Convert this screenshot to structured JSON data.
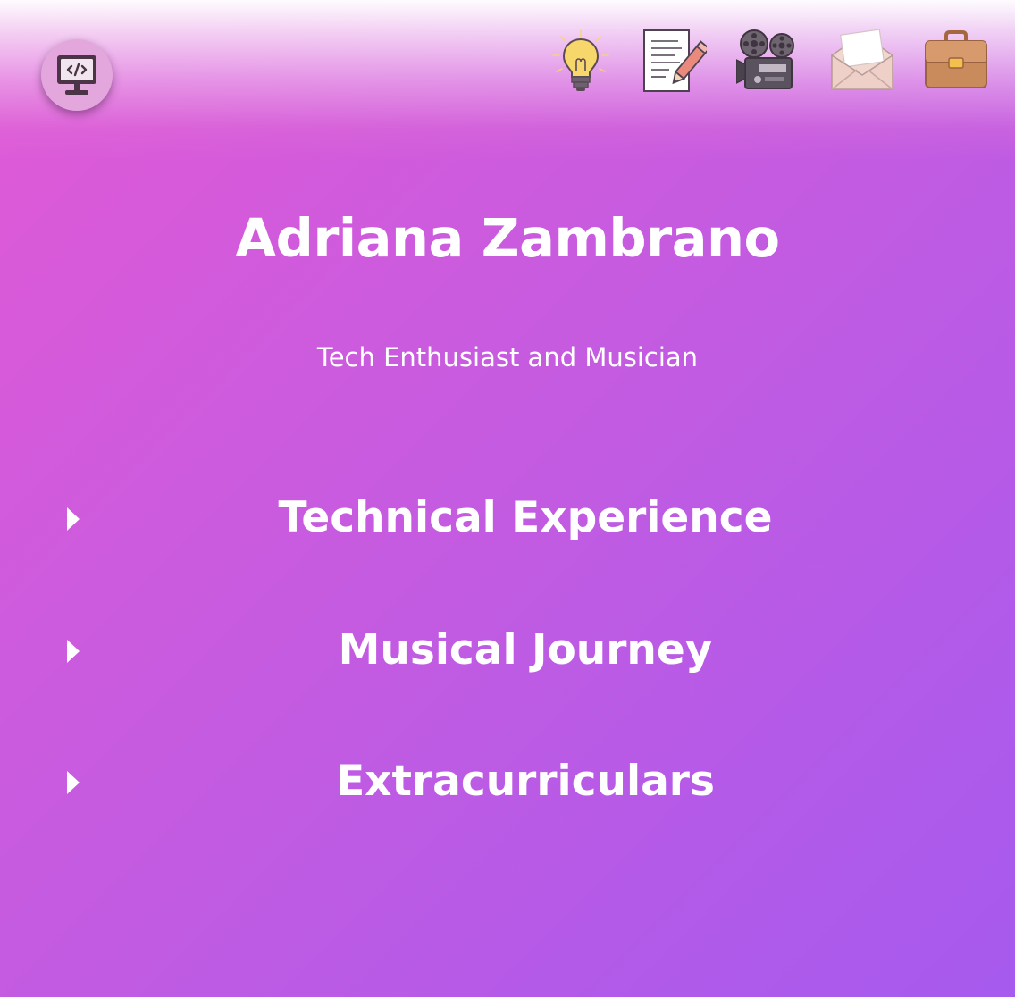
{
  "header": {
    "logo_icon": "monitor-code-icon",
    "nav": [
      {
        "name": "lightbulb-icon"
      },
      {
        "name": "notepad-pencil-icon"
      },
      {
        "name": "film-camera-icon"
      },
      {
        "name": "envelope-icon"
      },
      {
        "name": "briefcase-icon"
      }
    ]
  },
  "hero": {
    "name": "Adriana Zambrano",
    "tagline": "Tech Enthusiast and Musician"
  },
  "sections": [
    {
      "label": "Technical Experience",
      "icon": "caret-right-icon"
    },
    {
      "label": "Musical Journey",
      "icon": "caret-right-icon"
    },
    {
      "label": "Extracurriculars",
      "icon": "caret-right-icon"
    }
  ],
  "colors": {
    "gradient_start": "#e15ad6",
    "gradient_end": "#a65aee",
    "text": "#ffffff"
  }
}
